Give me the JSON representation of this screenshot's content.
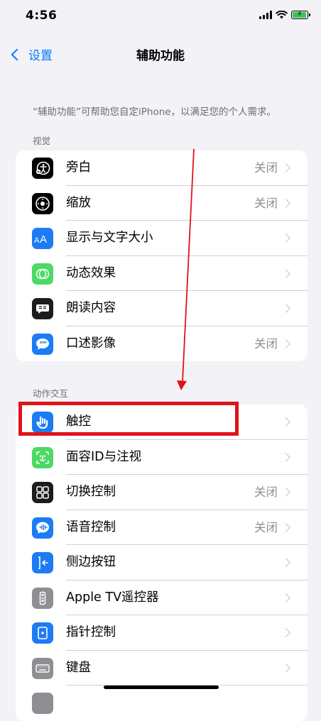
{
  "status_bar": {
    "time": "4:56"
  },
  "nav": {
    "back_label": "设置",
    "title": "辅助功能"
  },
  "intro_text": "“辅助功能”可帮助您自定iPhone，以满足您的个人需求。",
  "sections": {
    "vision": {
      "header": "视觉",
      "rows": [
        {
          "label": "旁白",
          "value": "关闭"
        },
        {
          "label": "缩放",
          "value": "关闭"
        },
        {
          "label": "显示与文字大小",
          "value": ""
        },
        {
          "label": "动态效果",
          "value": ""
        },
        {
          "label": "朗读内容",
          "value": ""
        },
        {
          "label": "口述影像",
          "value": "关闭"
        }
      ]
    },
    "interaction": {
      "header": "动作交互",
      "rows": [
        {
          "label": "触控",
          "value": ""
        },
        {
          "label": "面容ID与注视",
          "value": ""
        },
        {
          "label": "切换控制",
          "value": "关闭"
        },
        {
          "label": "语音控制",
          "value": "关闭"
        },
        {
          "label": "侧边按钮",
          "value": ""
        },
        {
          "label": "Apple TV遥控器",
          "value": ""
        },
        {
          "label": "指针控制",
          "value": ""
        },
        {
          "label": "键盘",
          "value": ""
        }
      ]
    }
  },
  "icons": {
    "voiceover": "voiceover-icon",
    "zoom": "zoom-icon",
    "display_text_size": "text-size-icon",
    "motion": "motion-icon",
    "spoken_content": "speech-bubble-icon",
    "audio_descriptions": "quote-bubble-icon",
    "touch": "hand-icon",
    "face_id": "face-id-icon",
    "switch_control": "grid-icon",
    "voice_control": "voice-control-icon",
    "side_button": "side-button-icon",
    "apple_tv_remote": "remote-icon",
    "pointer_control": "pointer-icon",
    "keyboard": "keyboard-icon"
  },
  "colors": {
    "accent": "#007aff",
    "highlight": "#e0121a",
    "annotation_arrow": "#e0121a"
  }
}
